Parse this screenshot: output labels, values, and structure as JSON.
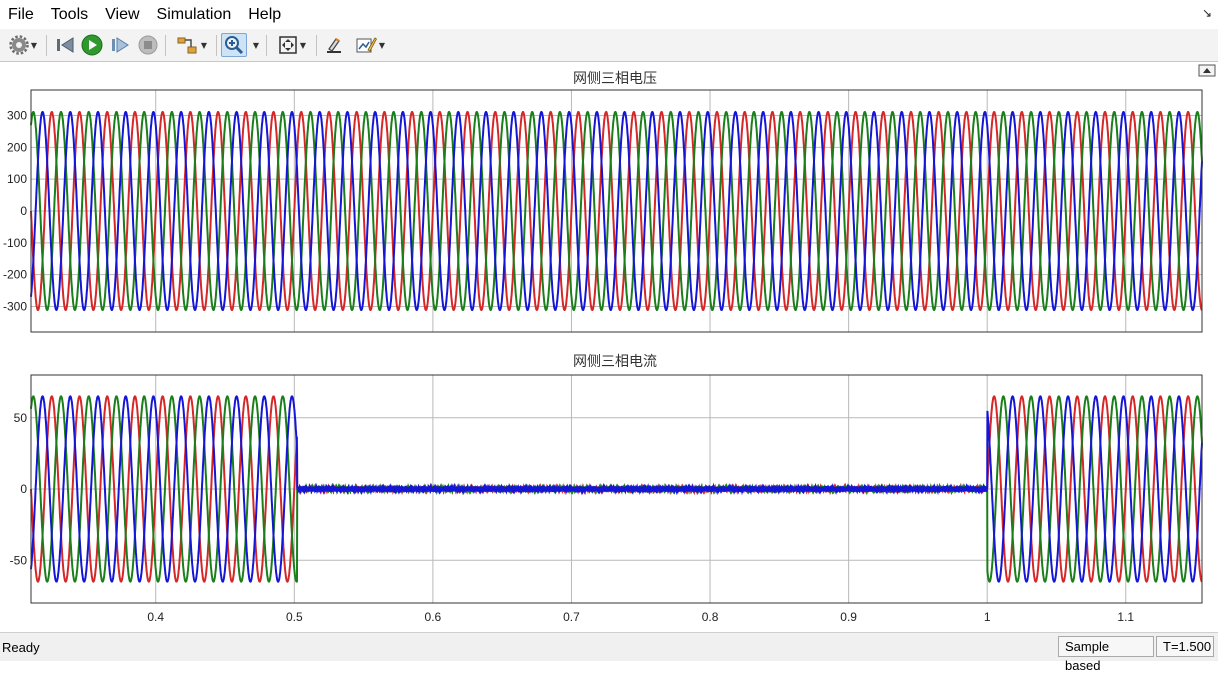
{
  "menu": {
    "items": [
      "File",
      "Tools",
      "View",
      "Simulation",
      "Help"
    ],
    "corner_icon": "dock-arrow-icon"
  },
  "toolbar": {
    "icons": [
      "settings-gear-icon",
      "step-back-icon",
      "run-icon",
      "step-forward-icon",
      "stop-icon",
      "signal-select-icon",
      "zoom-in-icon",
      "fit-to-view-icon",
      "highlight-block-icon",
      "edit-style-icon"
    ]
  },
  "colors": {
    "phase_a": "#d62728",
    "phase_b": "#1a7f1a",
    "phase_c": "#1515d6",
    "grid": "#b9b9b9",
    "axis_bg": "#ffffff"
  },
  "chart_data": [
    {
      "type": "line",
      "title": "网侧三相电压",
      "xlim": [
        0.31,
        1.155
      ],
      "ylim": [
        -380,
        380
      ],
      "yticks": [
        300,
        200,
        100,
        0,
        -100,
        -200,
        -300
      ],
      "xticks": [
        0.4,
        0.5,
        0.6,
        0.7,
        0.8,
        0.9,
        1.0,
        1.1
      ],
      "xtick_labels": [],
      "grid": true,
      "frequency_hz": 50,
      "series": [
        {
          "color": "#d62728",
          "amplitude": 311,
          "phase_deg": 0
        },
        {
          "color": "#1a7f1a",
          "amplitude": 311,
          "phase_deg": -120
        },
        {
          "color": "#1515d6",
          "amplitude": 311,
          "phase_deg": 120
        }
      ]
    },
    {
      "type": "line",
      "title": "网侧三相电流",
      "xlim": [
        0.31,
        1.155
      ],
      "ylim": [
        -80,
        80
      ],
      "yticks": [
        50,
        0,
        -50
      ],
      "xticks": [
        0.4,
        0.5,
        0.6,
        0.7,
        0.8,
        0.9,
        1.0,
        1.1
      ],
      "xtick_labels": [
        "0.4",
        "0.5",
        "0.6",
        "0.7",
        "0.8",
        "0.9",
        "1",
        "1.1"
      ],
      "grid": true,
      "frequency_hz": 50,
      "zero_current_interval": [
        0.502,
        1.0
      ],
      "series": [
        {
          "color": "#d62728",
          "amplitude": 65,
          "phase_deg": 0
        },
        {
          "color": "#1a7f1a",
          "amplitude": 65,
          "phase_deg": -120
        },
        {
          "color": "#1515d6",
          "amplitude": 65,
          "phase_deg": 120
        }
      ]
    }
  ],
  "status": {
    "left": "Ready",
    "mode": "Sample based",
    "time": "T=1.500"
  }
}
